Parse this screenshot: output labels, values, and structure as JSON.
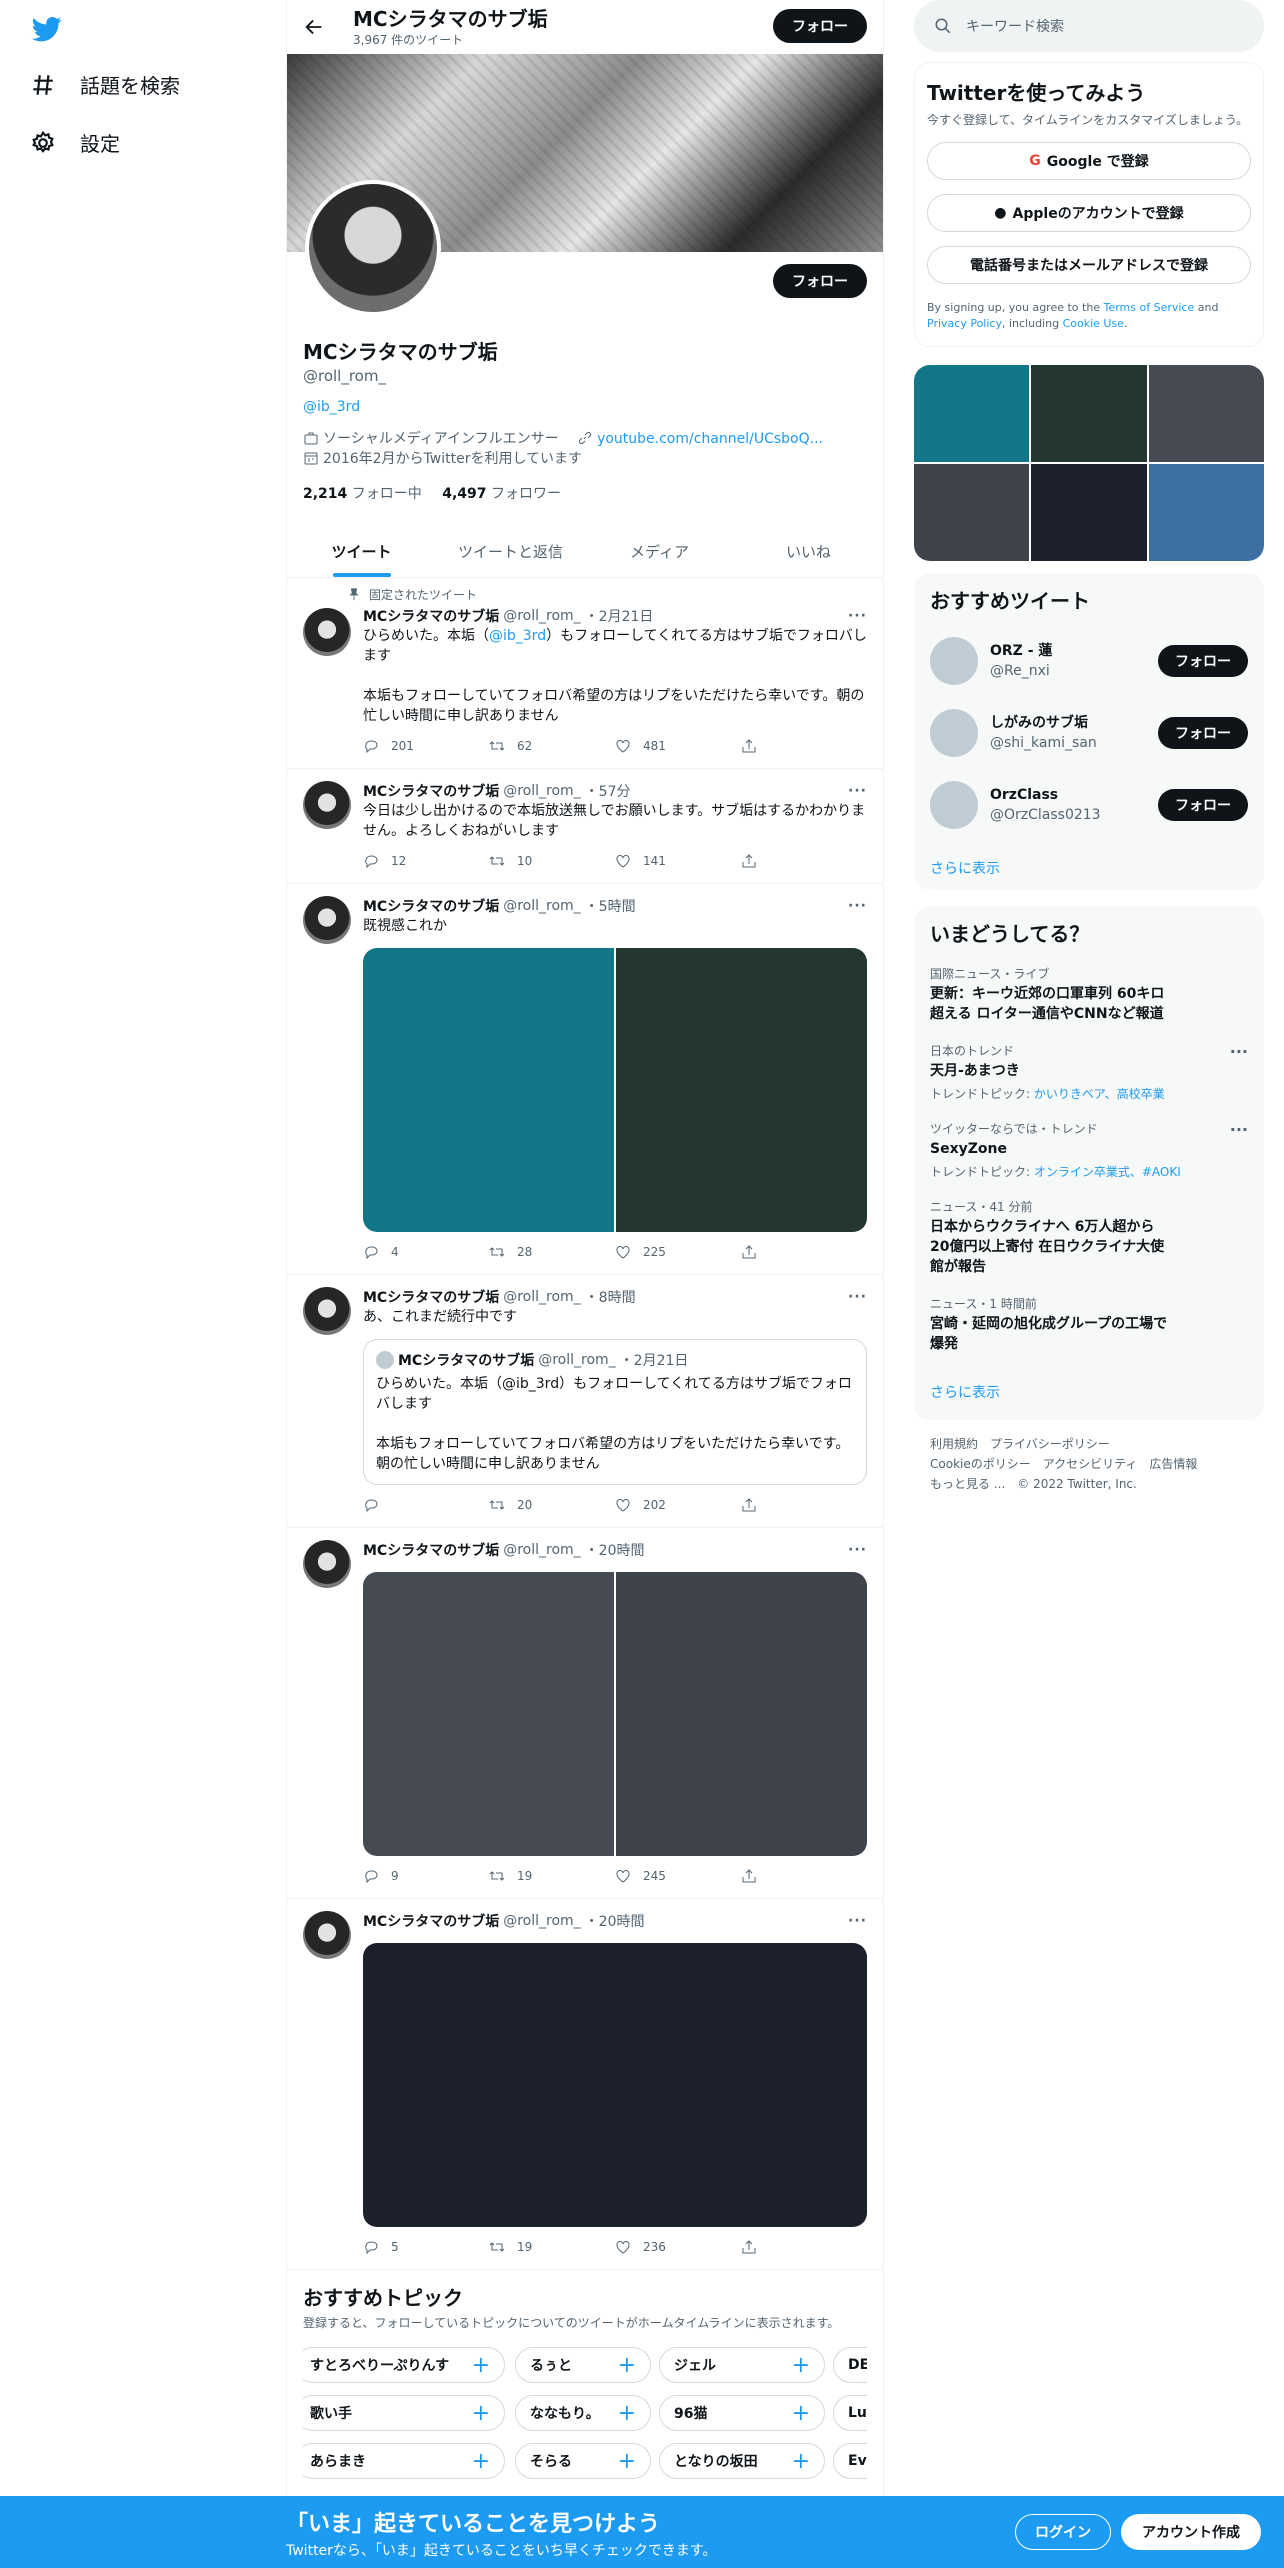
{
  "nav": {
    "explore_label": "話題を検索",
    "settings_label": "設定"
  },
  "header": {
    "title": "MCシラタマのサブ垢",
    "tweet_count": "3,967 件のツイート",
    "follow_label": "フォロー"
  },
  "profile": {
    "name": "MCシラタマのサブ垢",
    "handle": "@roll_rom_",
    "bio_link": "@ib_3rd",
    "category": "ソーシャルメディアインフルエンサー",
    "website": "youtube.com/channel/UCsboQ...",
    "joined": "2016年2月からTwitterを利用しています",
    "following_count": "2,214",
    "following_label": "フォロー中",
    "followers_count": "4,497",
    "followers_label": "フォロワー",
    "follow_label": "フォロー"
  },
  "tabs": [
    "ツイート",
    "ツイートと返信",
    "メディア",
    "いいね"
  ],
  "pinned_label": "固定されたツイート",
  "tweets": [
    {
      "name": "MCシラタマのサブ垢",
      "handle": "@roll_rom_",
      "time": "・2月21日",
      "text_a": "ひらめいた。本垢（",
      "text_link": "@ib_3rd",
      "text_b": "）もフォローしてくれてる方はサブ垢でフォロバします\n\n本垢もフォローしていてフォロバ希望の方はリプをいただけたら幸いです。朝の忙しい時間に申し訳ありません",
      "replies": "201",
      "retweets": "62",
      "likes": "481"
    },
    {
      "name": "MCシラタマのサブ垢",
      "handle": "@roll_rom_",
      "time": "・57分",
      "text": "今日は少し出かけるので本垢放送無しでお願いします。サブ垢はするかわかりません。よろしくおねがいします",
      "replies": "12",
      "retweets": "10",
      "likes": "141"
    },
    {
      "name": "MCシラタマのサブ垢",
      "handle": "@roll_rom_",
      "time": "・5時間",
      "text": "既視感これか",
      "media_colors": [
        "#117685",
        "#233630"
      ],
      "replies": "4",
      "retweets": "28",
      "likes": "225"
    },
    {
      "name": "MCシラタマのサブ垢",
      "handle": "@roll_rom_",
      "time": "・8時間",
      "text": "あ、これまだ続行中です",
      "quote": {
        "name": "MCシラタマのサブ垢",
        "handle": "@roll_rom_",
        "time": "・2月21日",
        "text": "ひらめいた。本垢（@ib_3rd）もフォローしてくれてる方はサブ垢でフォロバします\n\n本垢もフォローしていてフォロバ希望の方はリプをいただけたら幸いです。朝の忙しい時間に申し訳ありません"
      },
      "replies": "",
      "retweets": "20",
      "likes": "202"
    },
    {
      "name": "MCシラタマのサブ垢",
      "handle": "@roll_rom_",
      "time": "・20時間",
      "media_colors": [
        "#454a53",
        "#3f444c"
      ],
      "replies": "9",
      "retweets": "19",
      "likes": "245"
    },
    {
      "name": "MCシラタマのサブ垢",
      "handle": "@roll_rom_",
      "time": "・20時間",
      "media_color": "#1c202c",
      "replies": "5",
      "retweets": "19",
      "likes": "236"
    }
  ],
  "topics": {
    "title": "おすすめトピック",
    "desc": "登録すると、フォローしているトピックについてのツイートがホームタイムラインに表示されます。",
    "chips": [
      "すとろべりーぷりんす",
      "るぅと",
      "ジェル",
      "DEC",
      "歌い手",
      "ななもり。",
      "96猫",
      "Luz",
      "あらまき",
      "そらる",
      "となりの坂田",
      "Eve"
    ]
  },
  "search": {
    "placeholder": "キーワード検索"
  },
  "signup": {
    "title": "Twitterを使ってみよう",
    "subtitle": "今すぐ登録して、タイムラインをカスタマイズしましょう。",
    "google": "Google で登録",
    "apple": "Appleのアカウントで登録",
    "phone": "電話番号またはメールアドレスで登録",
    "legal_a": "By signing up, you agree to the ",
    "tos": "Terms of Service",
    "legal_b": " and ",
    "privacy": "Privacy Policy",
    "legal_c": ", including ",
    "cookie": "Cookie Use",
    "legal_d": "."
  },
  "media_grid_colors": [
    "#117685",
    "#233630",
    "#454a53",
    "#3f444c",
    "#1c202c",
    "#3d6fa5"
  ],
  "recommended": {
    "title": "おすすめツイート",
    "items": [
      {
        "name": "ORZ - 蓮",
        "handle": "@Re_nxi"
      },
      {
        "name": "しがみのサブ垢",
        "handle": "@shi_kami_san"
      },
      {
        "name": "OrzClass",
        "handle": "@OrzClass0213"
      }
    ],
    "follow_label": "フォロー",
    "more": "さらに表示"
  },
  "trends": {
    "title": "いまどうしてる？",
    "items": [
      {
        "context": "国際ニュース・ライブ",
        "title": "更新：キーウ近郊の口軍車列 60キロ超える ロイター通信やCNNなど報道",
        "desc": ""
      },
      {
        "context": "日本のトレンド",
        "title": "天月-あまつき",
        "desc_prefix": "トレンドトピック: ",
        "desc_links": "かいりきベア、高校卒業"
      },
      {
        "context": "ツイッターならでは・トレンド",
        "title": "SexyZone",
        "desc_prefix": "トレンドトピック: ",
        "desc_links": "オンライン卒業式、#AOKI"
      },
      {
        "context": "ニュース・41 分前",
        "title": "日本からウクライナへ 6万人超から20億円以上寄付 在日ウクライナ大使館が報告",
        "desc": ""
      },
      {
        "context": "ニュース・1 時間前",
        "title": "宮崎・延岡の旭化成グループの工場で爆発",
        "desc": ""
      }
    ],
    "more": "さらに表示"
  },
  "footer": {
    "line1": "利用規約　プライバシーポリシー",
    "line2": "Cookieのポリシー　アクセシビリティ　広告情報",
    "line3": "もっと見る ...　© 2022 Twitter, Inc."
  },
  "bottom": {
    "title": "「いま」起きていることを見つけよう",
    "subtitle": "Twitterなら、「いま」起きていることをいち早くチェックできます。",
    "login": "ログイン",
    "signup": "アカウント作成"
  },
  "colors": {
    "accent": "#1d9bf0",
    "dark": "#0f1419"
  }
}
